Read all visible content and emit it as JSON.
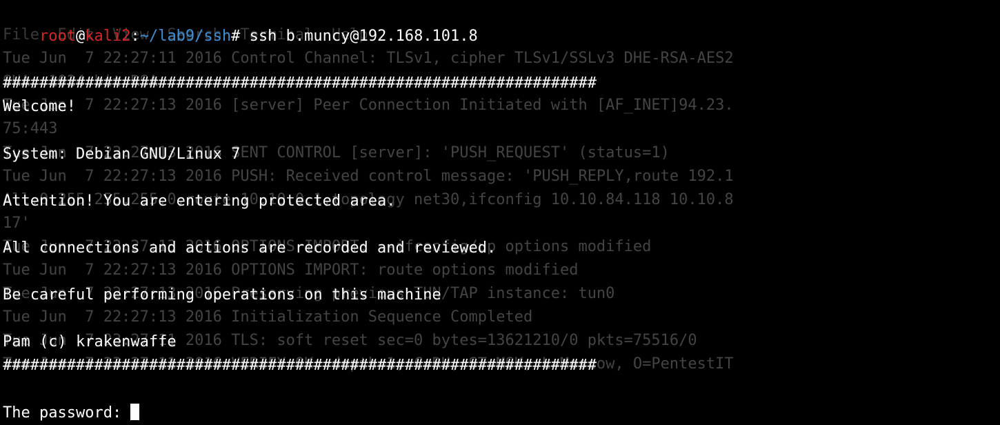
{
  "prompt": {
    "user": "root",
    "host": "kali2",
    "path": "~/lab9/ssh",
    "symbol": "#"
  },
  "command": "ssh b.muncy@192.168.101.8",
  "banner": {
    "sep": "#################################################################",
    "welcome": "Welcome!",
    "system": "System: Debian GNU/Linux 7",
    "attention": "Attention! You are entering protected area.",
    "recorded": "All connections and actions are recorded and reviewed.",
    "careful": "Be careful performing operations on this machine",
    "pam": "Pam (c) krakenwaffe"
  },
  "password_prompt": "The password: ",
  "menu": "File  Edit  View  Search  Terminal  Help",
  "bg": {
    "l1": "Tue Jun  7 22:27:11 2016 Control Channel: TLSv1, cipher TLSv1/SSLv3 DHE-RSA-AES2",
    "l2": "SHA, 1024 bit RSA",
    "l3": "Tue Jun  7 22:27:13 2016 [server] Peer Connection Initiated with [AF_INET]94.23.",
    "l4": "75:443",
    "l5": "Tue Jun  7 22:27:13 2016 SENT CONTROL [server]: 'PUSH_REQUEST' (status=1)",
    "l6": "Tue Jun  7 22:27:13 2016 PUSH: Received control message: 'PUSH_REPLY,route 192.1",
    "l7": "All.0 255.255.255.0,route 10.10.0.1,topology net30,ifconfig 10.10.84.118 10.10.8",
    "l8": "17'",
    "l9": "Tue Jun  7 22:27:13 2016 OPTIONS IMPORT: --ifconfig/up options modified",
    "l10": "Tue Jun  7 22:27:13 2016 OPTIONS IMPORT: route options modified",
    "l11": "Tue Jun  7 22:27:13 2016 Preserving previous TUN/TAP instance: tun0",
    "l12": "Tue Jun  7 22:27:13 2016 Initialization Sequence Completed",
    "l13": "Tue Jun  7 23:27:11 2016 TLS: soft reset sec=0 bytes=13621210/0 pkts=75516/0",
    "l14": "Tue Jun  7 23:27:11 2016 VERIFY OK: depth=1, C=RU, ST=MSK, L=Moscow, O=PentestIT"
  }
}
